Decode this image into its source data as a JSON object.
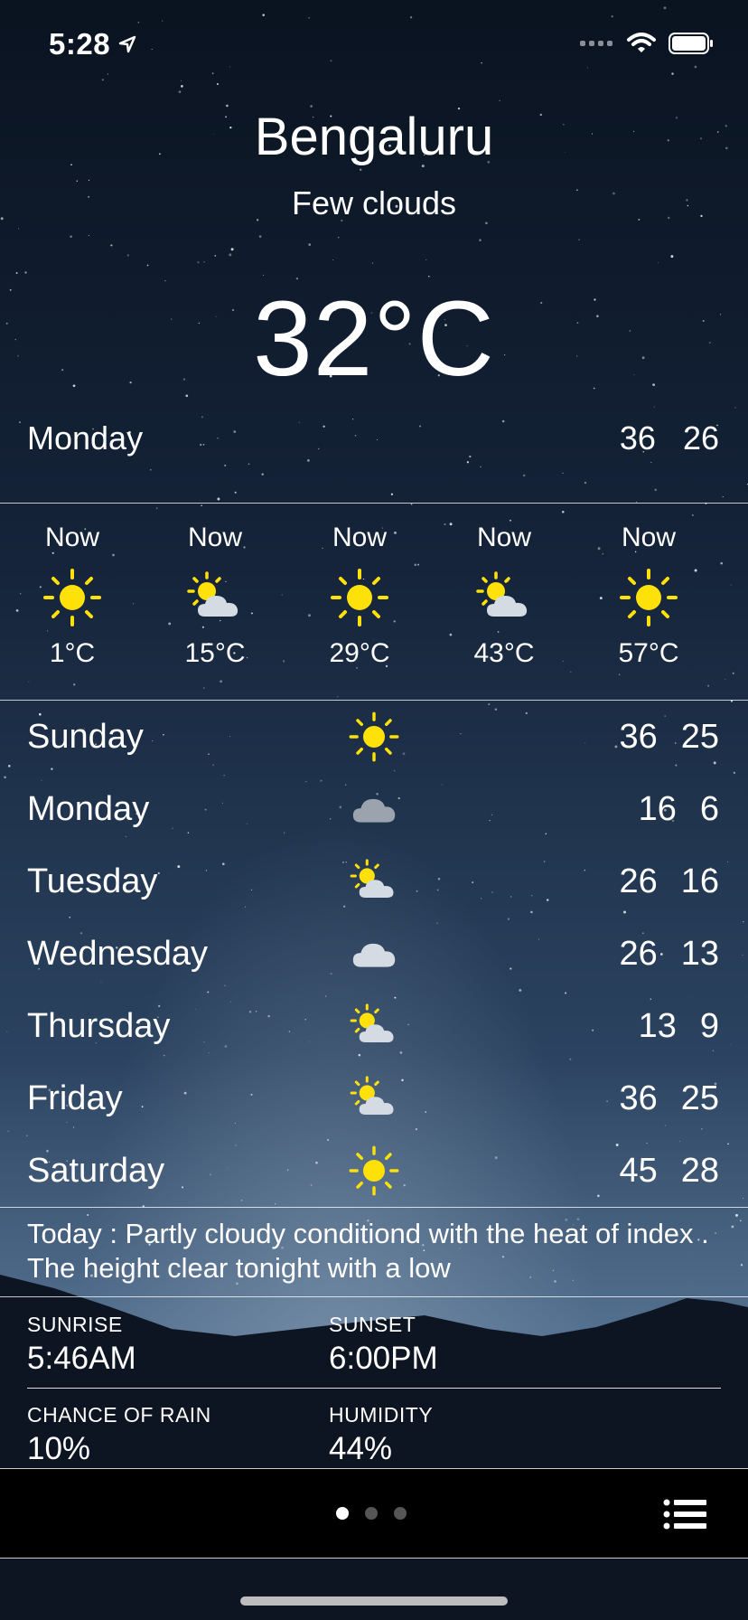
{
  "status": {
    "time": "5:28"
  },
  "header": {
    "city": "Bengaluru",
    "condition": "Few clouds",
    "temperature": "32°C"
  },
  "today": {
    "day": "Monday",
    "high": "36",
    "low": "26"
  },
  "hourly": [
    {
      "label": "Now",
      "icon": "sun-icon",
      "temp": "1°C"
    },
    {
      "label": "Now",
      "icon": "partly-cloudy-icon",
      "temp": "15°C"
    },
    {
      "label": "Now",
      "icon": "sun-icon",
      "temp": "29°C"
    },
    {
      "label": "Now",
      "icon": "partly-cloudy-icon",
      "temp": "43°C"
    },
    {
      "label": "Now",
      "icon": "sun-icon",
      "temp": "57°C"
    }
  ],
  "daily": [
    {
      "day": "Sunday",
      "icon": "sun-icon",
      "high": "36",
      "low": "25"
    },
    {
      "day": "Monday",
      "icon": "cloud-icon",
      "high": "16",
      "low": "6"
    },
    {
      "day": "Tuesday",
      "icon": "partly-cloudy-icon",
      "high": "26",
      "low": "16"
    },
    {
      "day": "Wednesday",
      "icon": "cloud-icon",
      "high": "26",
      "low": "13"
    },
    {
      "day": "Thursday",
      "icon": "partly-cloudy-icon",
      "high": "13",
      "low": "9"
    },
    {
      "day": "Friday",
      "icon": "partly-cloudy-icon",
      "high": "36",
      "low": "25"
    },
    {
      "day": "Saturday",
      "icon": "sun-icon",
      "high": "45",
      "low": "28"
    }
  ],
  "summary": "Today : Partly cloudy conditiond with the heat of index . The height clear tonight with a low",
  "details": {
    "sunrise_label": "SUNRISE",
    "sunrise": "5:46AM",
    "sunset_label": "SUNSET",
    "sunset": "6:00PM",
    "rain_label": "CHANCE OF RAIN",
    "rain": "10%",
    "humidity_label": "HUMIDITY",
    "humidity": "44%"
  },
  "pager": {
    "pages": 3,
    "active": 0
  },
  "colors": {
    "sun": "#FFE10A",
    "cloud": "#C9D1DB",
    "sky_top": "#0B1524",
    "sky_bottom": "#4A6384"
  }
}
